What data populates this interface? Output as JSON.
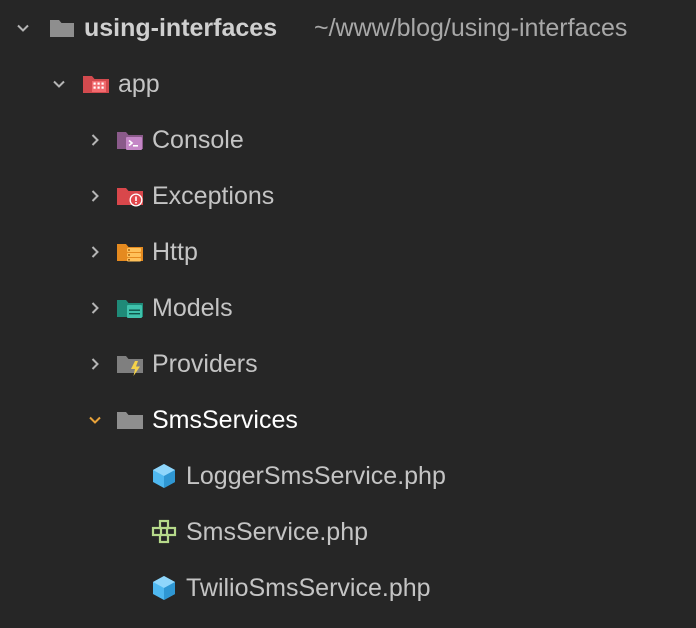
{
  "tree": {
    "root": {
      "name": "using-interfaces",
      "path": "~/www/blog/using-interfaces",
      "icon": "folder-icon",
      "expanded": true
    },
    "app": {
      "name": "app",
      "icon": "app-folder-icon",
      "expanded": true
    },
    "folders": [
      {
        "name": "Console",
        "icon": "console-folder-icon",
        "expanded": false
      },
      {
        "name": "Exceptions",
        "icon": "exceptions-folder-icon",
        "expanded": false
      },
      {
        "name": "Http",
        "icon": "http-folder-icon",
        "expanded": false
      },
      {
        "name": "Models",
        "icon": "models-folder-icon",
        "expanded": false
      },
      {
        "name": "Providers",
        "icon": "providers-folder-icon",
        "expanded": false
      },
      {
        "name": "SmsServices",
        "icon": "folder-icon",
        "expanded": true
      }
    ],
    "files": [
      {
        "name": "LoggerSmsService.php",
        "icon": "php-class-icon"
      },
      {
        "name": "SmsService.php",
        "icon": "php-interface-icon"
      },
      {
        "name": "TwilioSmsService.php",
        "icon": "php-class-icon"
      }
    ]
  },
  "colors": {
    "background": "#262626",
    "text": "#c4c4c4",
    "selected_text": "#ffffff",
    "expanded_accent": "#e8a23a",
    "class_icon": "#4fb8f0",
    "interface_icon": "#b6d98a"
  }
}
